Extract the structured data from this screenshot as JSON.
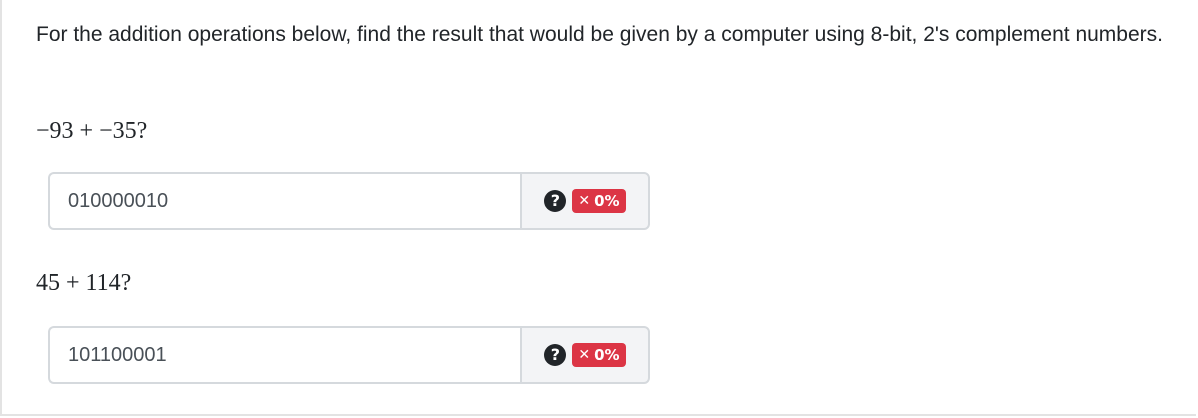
{
  "prompt": "For the addition operations below, find the result that would be given by a computer using 8-bit, 2's complement numbers.",
  "questions": [
    {
      "label": "−93 + −35?",
      "answer_value": "010000010",
      "help_glyph": "?",
      "score_icon": "✕",
      "score": "0%"
    },
    {
      "label": "45 + 114?",
      "answer_value": "101100001",
      "help_glyph": "?",
      "score_icon": "✕",
      "score": "0%"
    }
  ],
  "colors": {
    "badge_incorrect": "#dc3545",
    "addon_background": "#f3f4f6",
    "border": "#d5d9dd"
  },
  "icons": {
    "help": "question-circle-icon",
    "incorrect": "times-icon"
  }
}
